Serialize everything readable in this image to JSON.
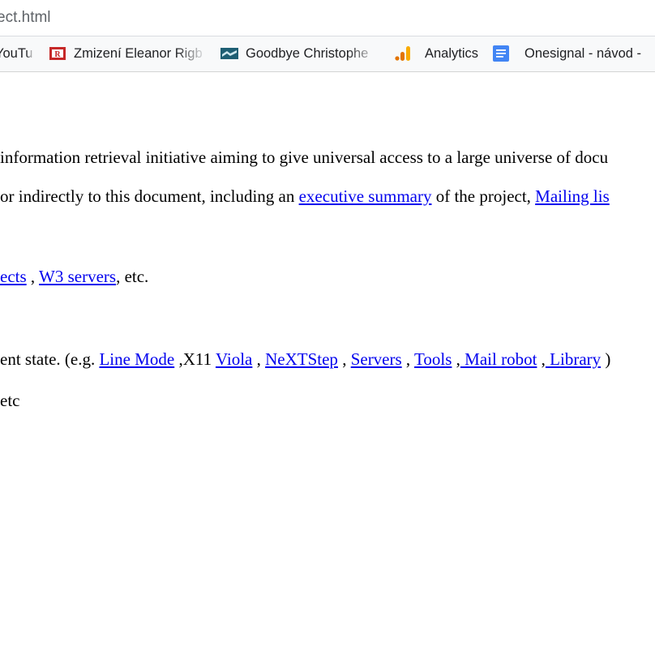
{
  "browser": {
    "url": "ect.html",
    "bookmarks": [
      {
        "label": "YouTu",
        "icon": "youtube-icon"
      },
      {
        "label": "Zmizení Eleanor Rigb",
        "icon": "book-icon"
      },
      {
        "label": "Goodbye Christophe",
        "icon": "landscape-icon"
      },
      {
        "label": "Analytics",
        "icon": "analytics-icon"
      },
      {
        "label": "Onesignal - návod -",
        "icon": "google-docs-icon"
      }
    ]
  },
  "document": {
    "line1": "information retrieval initiative aiming to give universal access to a large universe of docu",
    "line2": {
      "pre": " or indirectly to this document, including an ",
      "link1": "executive summary",
      "mid": " of the project, ",
      "link2": "Mailing lis"
    },
    "line3": {
      "link1": "ects",
      "sep": " , ",
      "link2": "W3 servers",
      "post": ", etc."
    },
    "line4": {
      "pre": "ent state. (e.g. ",
      "link_line_mode": "Line Mode",
      "x11": " ,X11 ",
      "link_viola": "Viola",
      "sep1": " , ",
      "link_nextstep": "NeXTStep",
      "sep2": " , ",
      "link_servers": "Servers",
      "sep3": " , ",
      "link_tools": "Tools",
      "sep4": " ,",
      "link_mail_robot": " Mail robot",
      "sep5": " ,",
      "link_library": " Library",
      "post": " )"
    },
    "line5": " etc"
  }
}
